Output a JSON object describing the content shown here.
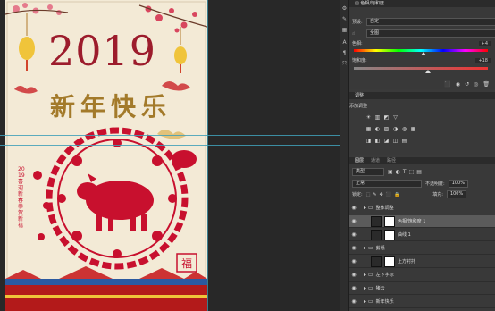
{
  "poster": {
    "year": "2019",
    "greeting": "新年快乐",
    "side_text": "2019 喜迎新春 恭贺新禧",
    "seal_text": "福"
  },
  "properties": {
    "header": "色相/饱和度",
    "preset_label": "预设:",
    "preset_value": "自定",
    "channel_value": "全图",
    "hue_label": "色相:",
    "hue_value": "+4",
    "saturation_label": "饱和度:",
    "saturation_value": "+18",
    "hue_level": 0.52,
    "saturation_level": 0.55
  },
  "adjustments": {
    "tab": "调整",
    "add_label": "添加调整",
    "icons_row1": [
      "☀",
      "▥",
      "◩",
      "▽"
    ],
    "icons_row2": [
      "▦",
      "◐",
      "▨",
      "◑",
      "◍",
      "▦"
    ],
    "icons_row3": [
      "◨",
      "◧",
      "◪",
      "◫",
      "▤"
    ]
  },
  "layers": {
    "tabs": [
      "图层",
      "通道",
      "路径"
    ],
    "kind_value": "类型",
    "blend_value": "正常",
    "opacity_label": "不透明度:",
    "opacity_value": "100%",
    "lock_label": "锁定:",
    "fill_label": "填充:",
    "fill_value": "100%",
    "items": [
      {
        "name": "整体调整",
        "type": "group"
      },
      {
        "name": "色相/饱和度 1",
        "type": "adjust",
        "selected": true
      },
      {
        "name": "曲线 1",
        "type": "adjust"
      },
      {
        "name": "剪纸",
        "type": "group"
      },
      {
        "name": "上方衬托",
        "type": "layer"
      },
      {
        "name": "左下字标",
        "type": "group"
      },
      {
        "name": "猪云",
        "type": "group"
      },
      {
        "name": "新年快乐",
        "type": "group"
      }
    ]
  },
  "colors": {
    "red": "#c8102e",
    "gold": "#b8913b",
    "bg": "#f3ead6"
  }
}
